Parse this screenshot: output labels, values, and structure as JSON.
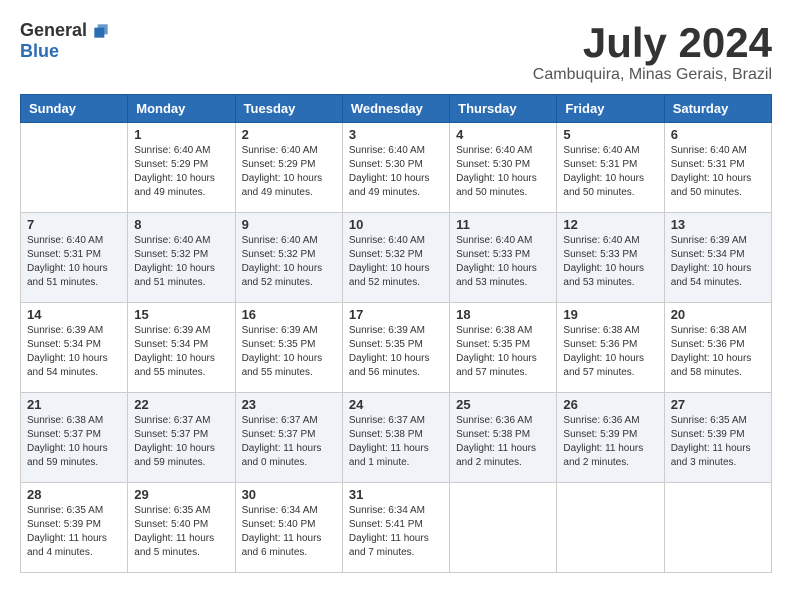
{
  "logo": {
    "general": "General",
    "blue": "Blue"
  },
  "title": {
    "month_year": "July 2024",
    "location": "Cambuquira, Minas Gerais, Brazil"
  },
  "days_of_week": [
    "Sunday",
    "Monday",
    "Tuesday",
    "Wednesday",
    "Thursday",
    "Friday",
    "Saturday"
  ],
  "weeks": [
    [
      {
        "day": "",
        "info": ""
      },
      {
        "day": "1",
        "info": "Sunrise: 6:40 AM\nSunset: 5:29 PM\nDaylight: 10 hours\nand 49 minutes."
      },
      {
        "day": "2",
        "info": "Sunrise: 6:40 AM\nSunset: 5:29 PM\nDaylight: 10 hours\nand 49 minutes."
      },
      {
        "day": "3",
        "info": "Sunrise: 6:40 AM\nSunset: 5:30 PM\nDaylight: 10 hours\nand 49 minutes."
      },
      {
        "day": "4",
        "info": "Sunrise: 6:40 AM\nSunset: 5:30 PM\nDaylight: 10 hours\nand 50 minutes."
      },
      {
        "day": "5",
        "info": "Sunrise: 6:40 AM\nSunset: 5:31 PM\nDaylight: 10 hours\nand 50 minutes."
      },
      {
        "day": "6",
        "info": "Sunrise: 6:40 AM\nSunset: 5:31 PM\nDaylight: 10 hours\nand 50 minutes."
      }
    ],
    [
      {
        "day": "7",
        "info": "Sunrise: 6:40 AM\nSunset: 5:31 PM\nDaylight: 10 hours\nand 51 minutes."
      },
      {
        "day": "8",
        "info": "Sunrise: 6:40 AM\nSunset: 5:32 PM\nDaylight: 10 hours\nand 51 minutes."
      },
      {
        "day": "9",
        "info": "Sunrise: 6:40 AM\nSunset: 5:32 PM\nDaylight: 10 hours\nand 52 minutes."
      },
      {
        "day": "10",
        "info": "Sunrise: 6:40 AM\nSunset: 5:32 PM\nDaylight: 10 hours\nand 52 minutes."
      },
      {
        "day": "11",
        "info": "Sunrise: 6:40 AM\nSunset: 5:33 PM\nDaylight: 10 hours\nand 53 minutes."
      },
      {
        "day": "12",
        "info": "Sunrise: 6:40 AM\nSunset: 5:33 PM\nDaylight: 10 hours\nand 53 minutes."
      },
      {
        "day": "13",
        "info": "Sunrise: 6:39 AM\nSunset: 5:34 PM\nDaylight: 10 hours\nand 54 minutes."
      }
    ],
    [
      {
        "day": "14",
        "info": "Sunrise: 6:39 AM\nSunset: 5:34 PM\nDaylight: 10 hours\nand 54 minutes."
      },
      {
        "day": "15",
        "info": "Sunrise: 6:39 AM\nSunset: 5:34 PM\nDaylight: 10 hours\nand 55 minutes."
      },
      {
        "day": "16",
        "info": "Sunrise: 6:39 AM\nSunset: 5:35 PM\nDaylight: 10 hours\nand 55 minutes."
      },
      {
        "day": "17",
        "info": "Sunrise: 6:39 AM\nSunset: 5:35 PM\nDaylight: 10 hours\nand 56 minutes."
      },
      {
        "day": "18",
        "info": "Sunrise: 6:38 AM\nSunset: 5:35 PM\nDaylight: 10 hours\nand 57 minutes."
      },
      {
        "day": "19",
        "info": "Sunrise: 6:38 AM\nSunset: 5:36 PM\nDaylight: 10 hours\nand 57 minutes."
      },
      {
        "day": "20",
        "info": "Sunrise: 6:38 AM\nSunset: 5:36 PM\nDaylight: 10 hours\nand 58 minutes."
      }
    ],
    [
      {
        "day": "21",
        "info": "Sunrise: 6:38 AM\nSunset: 5:37 PM\nDaylight: 10 hours\nand 59 minutes."
      },
      {
        "day": "22",
        "info": "Sunrise: 6:37 AM\nSunset: 5:37 PM\nDaylight: 10 hours\nand 59 minutes."
      },
      {
        "day": "23",
        "info": "Sunrise: 6:37 AM\nSunset: 5:37 PM\nDaylight: 11 hours\nand 0 minutes."
      },
      {
        "day": "24",
        "info": "Sunrise: 6:37 AM\nSunset: 5:38 PM\nDaylight: 11 hours\nand 1 minute."
      },
      {
        "day": "25",
        "info": "Sunrise: 6:36 AM\nSunset: 5:38 PM\nDaylight: 11 hours\nand 2 minutes."
      },
      {
        "day": "26",
        "info": "Sunrise: 6:36 AM\nSunset: 5:39 PM\nDaylight: 11 hours\nand 2 minutes."
      },
      {
        "day": "27",
        "info": "Sunrise: 6:35 AM\nSunset: 5:39 PM\nDaylight: 11 hours\nand 3 minutes."
      }
    ],
    [
      {
        "day": "28",
        "info": "Sunrise: 6:35 AM\nSunset: 5:39 PM\nDaylight: 11 hours\nand 4 minutes."
      },
      {
        "day": "29",
        "info": "Sunrise: 6:35 AM\nSunset: 5:40 PM\nDaylight: 11 hours\nand 5 minutes."
      },
      {
        "day": "30",
        "info": "Sunrise: 6:34 AM\nSunset: 5:40 PM\nDaylight: 11 hours\nand 6 minutes."
      },
      {
        "day": "31",
        "info": "Sunrise: 6:34 AM\nSunset: 5:41 PM\nDaylight: 11 hours\nand 7 minutes."
      },
      {
        "day": "",
        "info": ""
      },
      {
        "day": "",
        "info": ""
      },
      {
        "day": "",
        "info": ""
      }
    ]
  ]
}
